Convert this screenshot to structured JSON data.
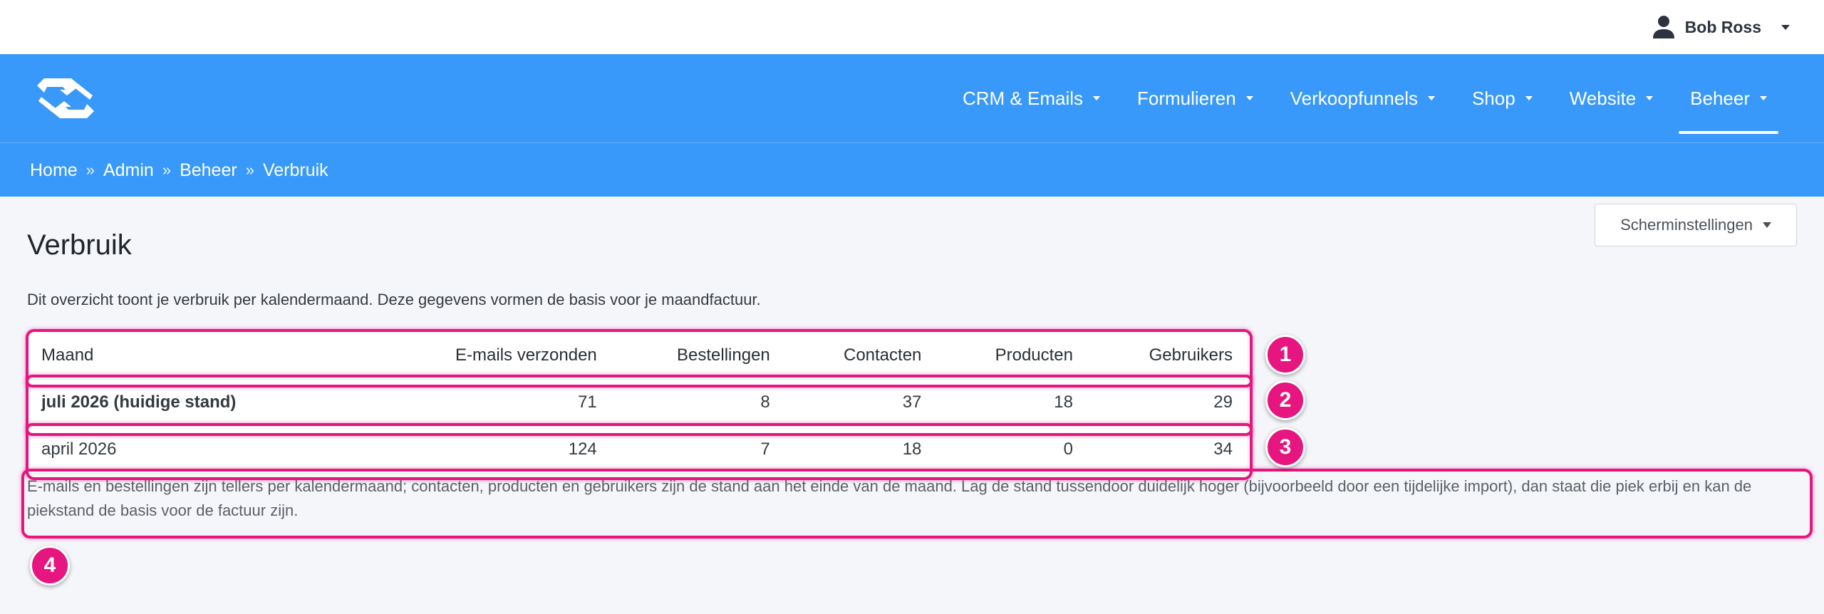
{
  "user": {
    "name": "Bob Ross"
  },
  "nav": {
    "items": [
      {
        "label": "CRM & Emails"
      },
      {
        "label": "Formulieren"
      },
      {
        "label": "Verkoopfunnels"
      },
      {
        "label": "Shop"
      },
      {
        "label": "Website"
      },
      {
        "label": "Beheer",
        "active": true
      }
    ]
  },
  "breadcrumb": [
    "Home",
    "Admin",
    "Beheer",
    "Verbruik"
  ],
  "breadcrumb_separator": "»",
  "page": {
    "title": "Verbruik",
    "settings_label": "Scherminstellingen",
    "intro": "Dit overzicht toont je verbruik per kalendermaand. Deze gegevens vormen de basis voor je maandfactuur.",
    "footnote": "E-mails en bestellingen zijn tellers per kalendermaand; contacten, producten en gebruikers zijn de stand aan het einde van de maand. Lag de stand tussendoor duidelijk hoger (bijvoorbeeld door een tijdelijke import), dan staat die piek erbij en kan de piekstand de basis voor de factuur zijn."
  },
  "table": {
    "headers": [
      "Maand",
      "E-mails verzonden",
      "Bestellingen",
      "Contacten",
      "Producten",
      "Gebruikers"
    ],
    "rows": [
      {
        "cells": [
          "juli 2026 (huidige stand)",
          "71",
          "8",
          "37",
          "18",
          "29"
        ]
      },
      {
        "cells": [
          "april 2026",
          "124",
          "7",
          "18",
          "0",
          "34"
        ]
      }
    ]
  },
  "annotations": [
    "1",
    "2",
    "3",
    "4"
  ],
  "colors": {
    "brand": "#3899fb",
    "annotation": "#e6157f",
    "background": "#f5f6fa"
  },
  "icons": {
    "user": "person-icon",
    "logo": "logo-mark-icon"
  }
}
